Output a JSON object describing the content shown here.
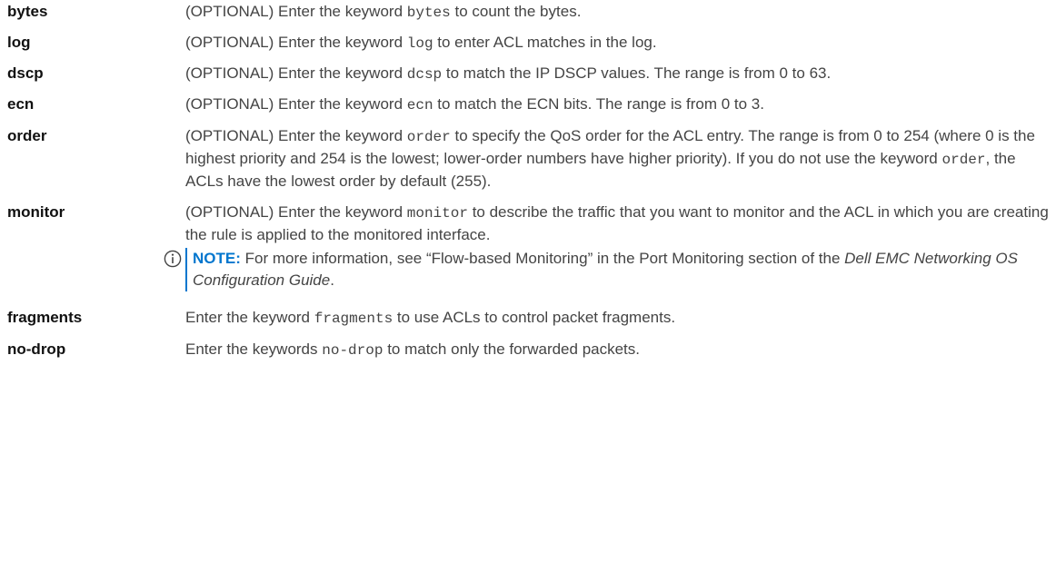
{
  "rows": [
    {
      "term": "bytes",
      "pre": "(OPTIONAL) Enter the keyword ",
      "code": "bytes",
      "post": " to count the bytes."
    },
    {
      "term": "log",
      "pre": "(OPTIONAL) Enter the keyword ",
      "code": "log",
      "post": " to enter ACL matches in the log."
    },
    {
      "term": "dscp",
      "pre": "(OPTIONAL) Enter the keyword ",
      "code": "dcsp",
      "post": " to match the IP DSCP values. The range is from 0 to 63."
    },
    {
      "term": "ecn",
      "pre": "(OPTIONAL) Enter the keyword ",
      "code": "ecn",
      "post": " to match the ECN bits. The range is from 0 to 3."
    },
    {
      "term": "order",
      "pre": "(OPTIONAL) Enter the keyword ",
      "code": "order",
      "post": " to specify the QoS order for the ACL entry. The range is from 0 to 254 (where 0 is the highest priority and 254 is the lowest; lower-order numbers have higher priority). If you do not use the keyword ",
      "code2": "order",
      "post2": ", the ACLs have the lowest order by default (255)."
    },
    {
      "term": "monitor",
      "pre": "(OPTIONAL) Enter the keyword ",
      "code": "monitor",
      "post": " to describe the traffic that you want to monitor and the ACL in which you are creating the rule is applied to the monitored interface.",
      "note": {
        "label": "NOTE:",
        "text_pre": " For more information, see “Flow-based Monitoring” in the Port Monitoring section of the ",
        "guide": "Dell EMC Networking OS Configuration Guide",
        "text_post": "."
      }
    },
    {
      "term": "fragments",
      "pre": "Enter the keyword ",
      "code": "fragments",
      "post": " to use ACLs to control packet fragments."
    },
    {
      "term": "no-drop",
      "pre": "Enter the keywords ",
      "code": "no-drop",
      "post": " to match only the forwarded packets."
    }
  ],
  "icons": {
    "note": "info-circle-icon"
  },
  "colors": {
    "accent": "#0076ce",
    "term": "#111111",
    "text": "#444444"
  }
}
